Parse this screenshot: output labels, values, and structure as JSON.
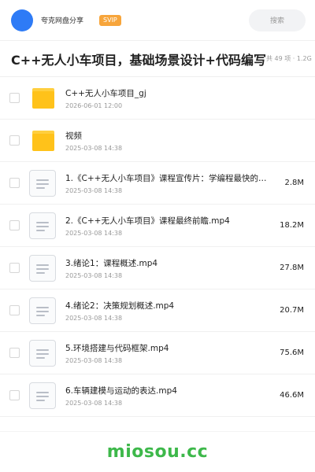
{
  "header": {
    "username": "夸克网盘分享",
    "badge": "SVIP",
    "search_placeholder": "搜索"
  },
  "title": {
    "text": "C++无人小车项目，基础场景设计+代码编写",
    "meta": "共 49 项 · 1.2G"
  },
  "files": [
    {
      "type": "folder",
      "name": "C++无人小车项目_gj",
      "date": "2026-06-01 12:00",
      "size": ""
    },
    {
      "type": "folder",
      "name": "视频",
      "date": "2025-03-08 14:38",
      "size": ""
    },
    {
      "type": "file",
      "name": "1.《C++无人小车项目》课程宣传片：学编程最快的…",
      "date": "2025-03-08 14:38",
      "size": "2.8M"
    },
    {
      "type": "file",
      "name": "2.《C++无人小车项目》课程最终前瞻.mp4",
      "date": "2025-03-08 14:38",
      "size": "18.2M"
    },
    {
      "type": "file",
      "name": "3.绪论1：课程概述.mp4",
      "date": "2025-03-08 14:38",
      "size": "27.8M"
    },
    {
      "type": "file",
      "name": "4.绪论2：决策规划概述.mp4",
      "date": "2025-03-08 14:38",
      "size": "20.7M"
    },
    {
      "type": "file",
      "name": "5.环境搭建与代码框架.mp4",
      "date": "2025-03-08 14:38",
      "size": "75.6M"
    },
    {
      "type": "file",
      "name": "6.车辆建模与运动的表达.mp4",
      "date": "2025-03-08 14:38",
      "size": "46.6M"
    }
  ],
  "footer": {
    "brand": "miosou.cc"
  },
  "colors": {
    "accent": "#2e7bf6",
    "badge": "#f7a53b",
    "folder": "#ffc21a",
    "brand": "#3db84a"
  }
}
